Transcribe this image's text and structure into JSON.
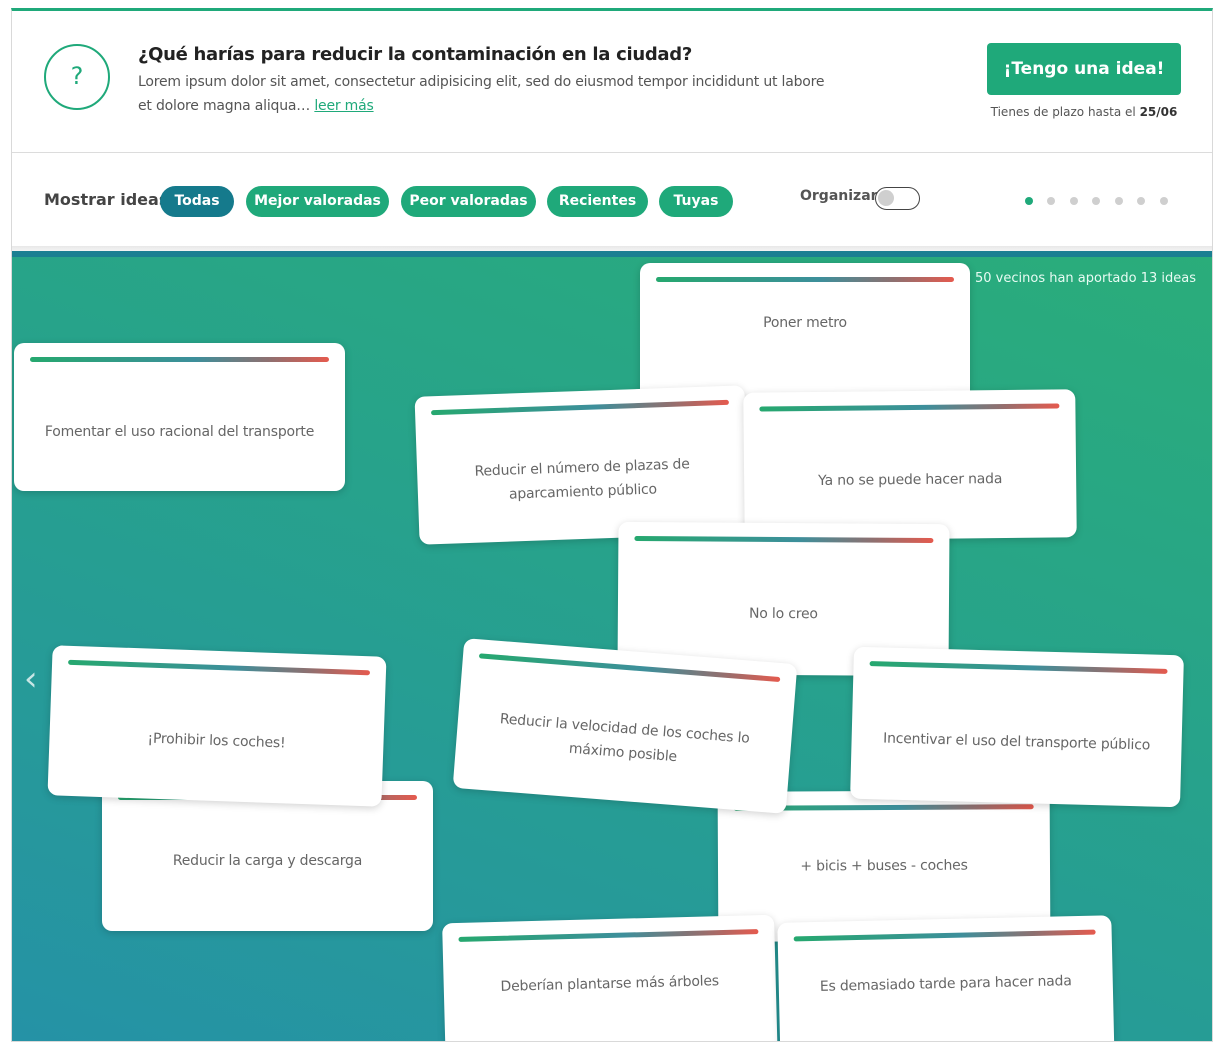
{
  "header": {
    "icon": "question-mark-icon",
    "icon_glyph": "?",
    "title": "¿Qué harías para reducir la contaminación en la ciudad?",
    "description": "Lorem ipsum dolor sit amet, consectetur adipisicing elit, sed do eiusmod tempor incididunt ut labore et dolore magna aliqua…",
    "read_more": "leer más",
    "cta_label": "¡Tengo una idea!",
    "deadline_prefix": "Tienes de plazo hasta el",
    "deadline_date": "25/06"
  },
  "filters": {
    "label": "Mostrar ideas",
    "chips": [
      "Todas",
      "Mejor valoradas",
      "Peor valoradas",
      "Recientes",
      "Tuyas"
    ],
    "active": "Todas",
    "organize_label": "Organizar",
    "organize_on": false,
    "pages": 7,
    "current_page": 1
  },
  "board": {
    "summary": "50 vecinos han aportado 13 ideas",
    "prev_glyph": "‹",
    "next_glyph": "›",
    "ideas": [
      "Poner metro",
      "Fomentar el uso racional del transporte",
      "Reducir el número de plazas de aparcamiento público",
      "Ya no se puede hacer nada",
      "No lo creo",
      "Reducir la carga y descarga",
      "¡Prohibir los coches!",
      "Reducir la velocidad de los coches lo máximo posible",
      "+ bicis + buses - coches",
      "Incentivar el uso del transporte público",
      "Deberían plantarse más árboles",
      "Es demasiado tarde para hacer nada"
    ]
  },
  "colors": {
    "brand": "#1fa97a",
    "active_chip": "#157a8c",
    "bar_start": "#26a86f",
    "bar_end": "#e55a4e"
  }
}
